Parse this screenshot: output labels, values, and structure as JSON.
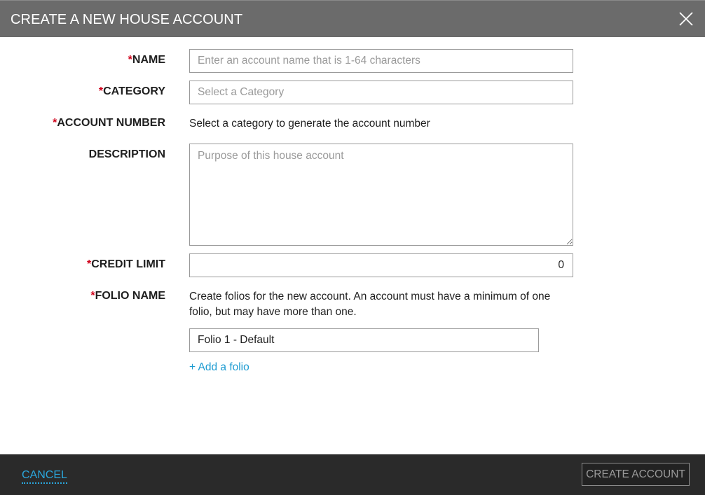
{
  "dialog": {
    "title": "CREATE A NEW HOUSE ACCOUNT"
  },
  "form": {
    "required_marker": "*",
    "name": {
      "label": "NAME",
      "placeholder": "Enter an account name that is 1-64 characters",
      "value": ""
    },
    "category": {
      "label": "CATEGORY",
      "placeholder": "Select a Category"
    },
    "account_number": {
      "label": "ACCOUNT NUMBER",
      "text": "Select a category to generate the account number"
    },
    "description": {
      "label": "DESCRIPTION",
      "placeholder": "Purpose of this house account",
      "value": ""
    },
    "credit_limit": {
      "label": "CREDIT LIMIT",
      "value": "0"
    },
    "folio": {
      "label": "FOLIO NAME",
      "description": "Create folios for the new account. An account must have a minimum of one folio, but may have more than one.",
      "folios": [
        "Folio 1 - Default"
      ],
      "add_label": "+ Add a folio"
    }
  },
  "footer": {
    "cancel_label": "CANCEL",
    "create_label": "CREATE ACCOUNT"
  },
  "colors": {
    "titlebar": "#6b6b6b",
    "required": "#d0021b",
    "link": "#1c9bd1",
    "footer": "#2a2a2a"
  }
}
